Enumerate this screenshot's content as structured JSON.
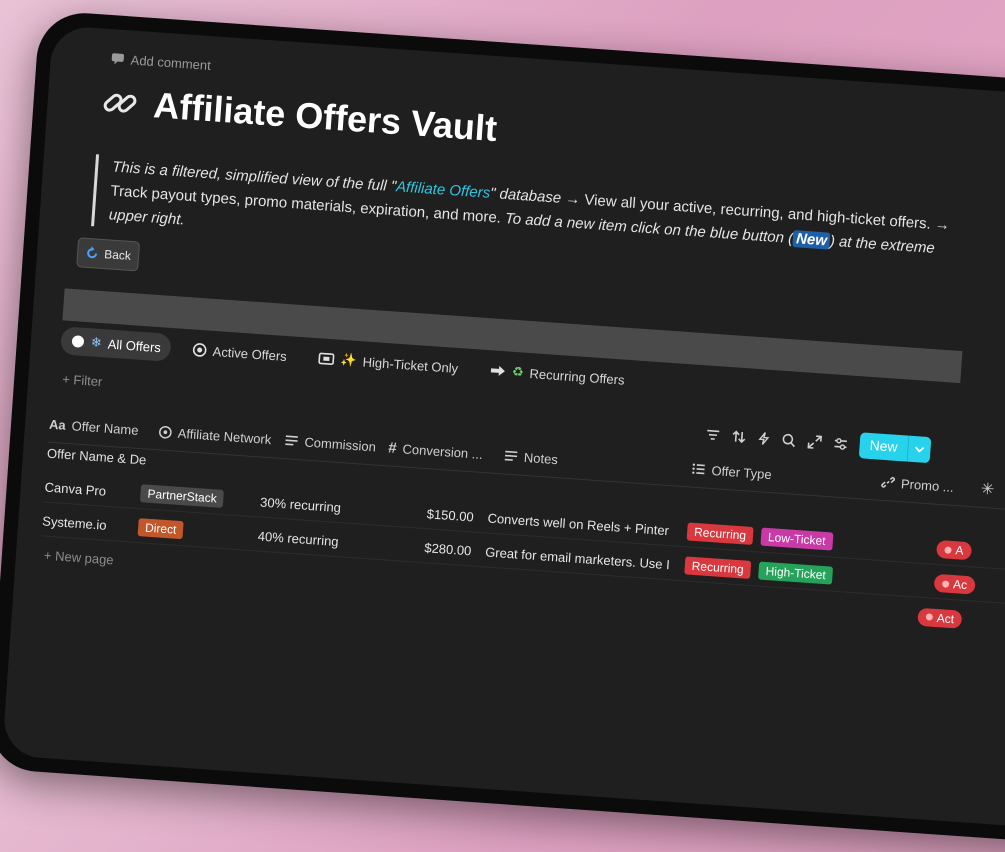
{
  "page": {
    "add_comment": "Add comment",
    "title": "Affiliate Offers Vault"
  },
  "callout": {
    "part1": "This is a filtered, simplified view of the full \"",
    "link": "Affiliate Offers",
    "part2": "\" database",
    "part3": " → View all your active, recurring, and high-ticket offers. → Track payout types, promo materials, expiration, and more.",
    "part4": " To add a new item click on the blue button (",
    "new_word": "New",
    "part5": ") at the extreme upper right."
  },
  "back_button": "Back",
  "views": {
    "all": "All Offers",
    "active": "Active Offers",
    "high_ticket": "High-Ticket Only",
    "recurring": "Recurring Offers"
  },
  "filter_label": "+ Filter",
  "toolbar": {
    "new_label": "New"
  },
  "columns": {
    "offer_name": "Offer Name",
    "affiliate_network": "Affiliate Network",
    "commission": "Commission",
    "conversion": "Conversion ...",
    "notes": "Notes",
    "offer_type": "Offer Type",
    "promo": "Promo ..."
  },
  "subheader": "Offer Name & De",
  "rows": [
    {
      "name": "Canva Pro",
      "network": "PartnerStack",
      "commission": "30% recurring",
      "conversion": "$150.00",
      "notes": "Converts well on Reels + Pinter",
      "type1": "Recurring",
      "type2": "Low-Ticket",
      "status": "A"
    },
    {
      "name": "Systeme.io",
      "network": "Direct",
      "commission": "40% recurring",
      "conversion": "$280.00",
      "notes": "Great for email marketers. Use I",
      "type1": "Recurring",
      "type2": "High-Ticket",
      "status": "Ac"
    }
  ],
  "extra_status": "Act",
  "new_page": "New page",
  "colors": {
    "accent": "#27d3ec",
    "link": "#30c6e0",
    "recurring": "#d9383f",
    "low_ticket": "#c93aa6",
    "high_ticket": "#26a35a",
    "direct": "#c2572b"
  },
  "icons": [
    "comment-icon",
    "link-icon",
    "refresh-icon",
    "snowflake-icon",
    "target-icon",
    "ticket-icon",
    "arrow-icon",
    "recycle-icon",
    "filter-lines-icon",
    "sort-icon",
    "lightning-icon",
    "search-icon",
    "expand-icon",
    "sliders-icon",
    "chevron-down-icon",
    "text-icon",
    "list-icon",
    "hash-icon",
    "spinner-icon",
    "plus-icon"
  ]
}
